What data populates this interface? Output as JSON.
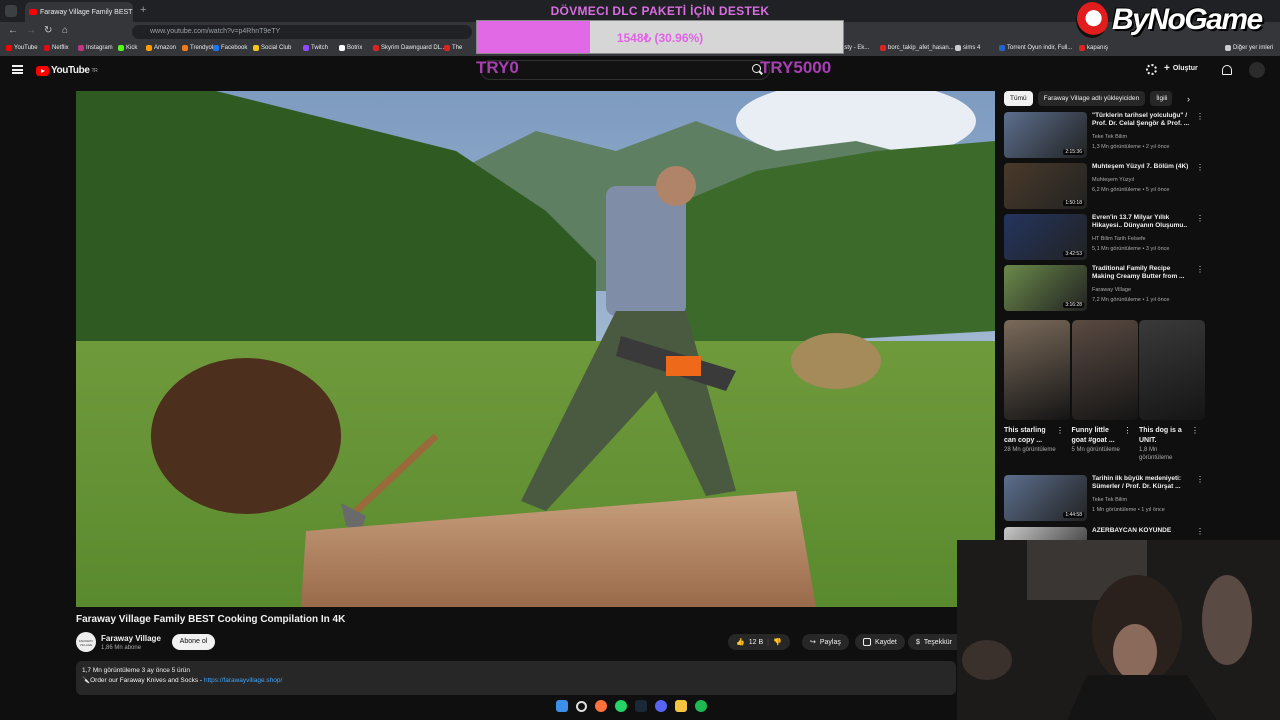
{
  "browser": {
    "tab_title": "Faraway Village Family BEST",
    "url": "www.youtube.com/watch?v=p4RhnT9eTY",
    "bookmarks": [
      "YouTube",
      "Netflix",
      "Instagram",
      "Kick",
      "Amazon",
      "Trendyol",
      "Facebook",
      "Social Club",
      "Twitch",
      "Botrix",
      "Skyrim Dawnguard DL...",
      "The",
      "asty - Ek...",
      "borc_takip_afet_hasan...",
      "sims 4",
      "Torrent Oyun indir, Full...",
      "kapanış",
      "Diğer yer imleri"
    ],
    "bookmark_colors": [
      "#ff0000",
      "#e50914",
      "#c13584",
      "#53fc18",
      "#ff9900",
      "#f27a1a",
      "#1877f2",
      "#f5c518",
      "#9146ff",
      "#ffffff",
      "#dd2222",
      "#dd2222",
      "#aaaaaa",
      "#dd2222",
      "#cccccc",
      "#2266cc",
      "#dd2222",
      "#cccccc"
    ]
  },
  "overlay": {
    "title": "DÖVMECI DLC PAKETİ İÇİN DESTEK",
    "progress_text": "1548₺ (30.96%)",
    "progress_fraction": 0.3096,
    "min_label": "TRY0",
    "max_label": "TRY5000",
    "brand": "ByNoGame"
  },
  "youtube": {
    "logo": "YouTube",
    "logo_region": "TR",
    "create_label": "Oluştur",
    "video": {
      "title": "Faraway Village Family BEST Cooking Compilation In 4K",
      "channel": "Faraway Village",
      "channel_avatar_text": "FARAWAY VILLAGE",
      "subscribers": "1,86 Mn abone",
      "subscribe_label": "Abone ol",
      "likes": "12 B",
      "share_label": "Paylaş",
      "save_label": "Kaydet",
      "thanks_label": "Teşekkür",
      "description_meta": "1,7 Mn görüntüleme  3 ay önce  5 ürün",
      "description_line": "🔪Order our Faraway Knives and Socks - ",
      "description_link": "https://farawayvillage.shop/"
    },
    "chips": [
      "Tümü",
      "Faraway Village adlı yükleyiciden",
      "İlgili"
    ],
    "recommendations": [
      {
        "title": "\"Türklerin tarihsel yolculuğu\" / Prof. Dr. Celal Şengör & Prof. ...",
        "channel": "Teke Tek Bilim",
        "meta": "1,3 Mn görüntüleme • 2 yıl önce",
        "duration": "2:15:36",
        "color": "#5c6f8e"
      },
      {
        "title": "Muhteşem Yüzyıl 7. Bölüm (4K)",
        "channel": "Muhteşem Yüzyıl",
        "meta": "6,2 Mn görüntüleme • 5 yıl önce",
        "duration": "1:50:18",
        "color": "#4a3a2a"
      },
      {
        "title": "Evren'in 13.7 Milyar Yıllık Hikayesi.. Dünyanın Oluşumu..",
        "channel": "HT Bilim Tarih Felsefe",
        "meta": "5,1 Mn görüntüleme • 3 yıl önce",
        "duration": "3:42:53",
        "color": "#23345e"
      },
      {
        "title": "Traditional Family Recipe Making Creamy Butter from ...",
        "channel": "Faraway Village",
        "meta": "7,2 Mn görüntüleme • 1 yıl önce",
        "duration": "3:16:28",
        "color": "#6b8a4a"
      },
      {
        "title": "Tarihin ilk büyük medeniyeti: Sümerler / Prof. Dr. Kürşat ...",
        "channel": "Teke Tek Bilim",
        "meta": "1 Mn görüntüleme • 1 yıl önce",
        "duration": "1:44:58",
        "color": "#5c6f8e"
      },
      {
        "title": "AZERBAYCAN KÖYÜNDE",
        "channel": "",
        "meta": "",
        "duration": "",
        "color": "#c8c8c8"
      }
    ],
    "shorts": [
      {
        "title": "This starling can copy ...",
        "views": "28 Mn görüntüleme",
        "color": "#7a6a5a"
      },
      {
        "title": "Funny little goat #goat ...",
        "views": "5 Mn görüntüleme",
        "color": "#5a4a42"
      },
      {
        "title": "This dog is a UNIT.",
        "views": "1,8 Mn görüntüleme",
        "color": "#3a3a3a"
      }
    ]
  }
}
